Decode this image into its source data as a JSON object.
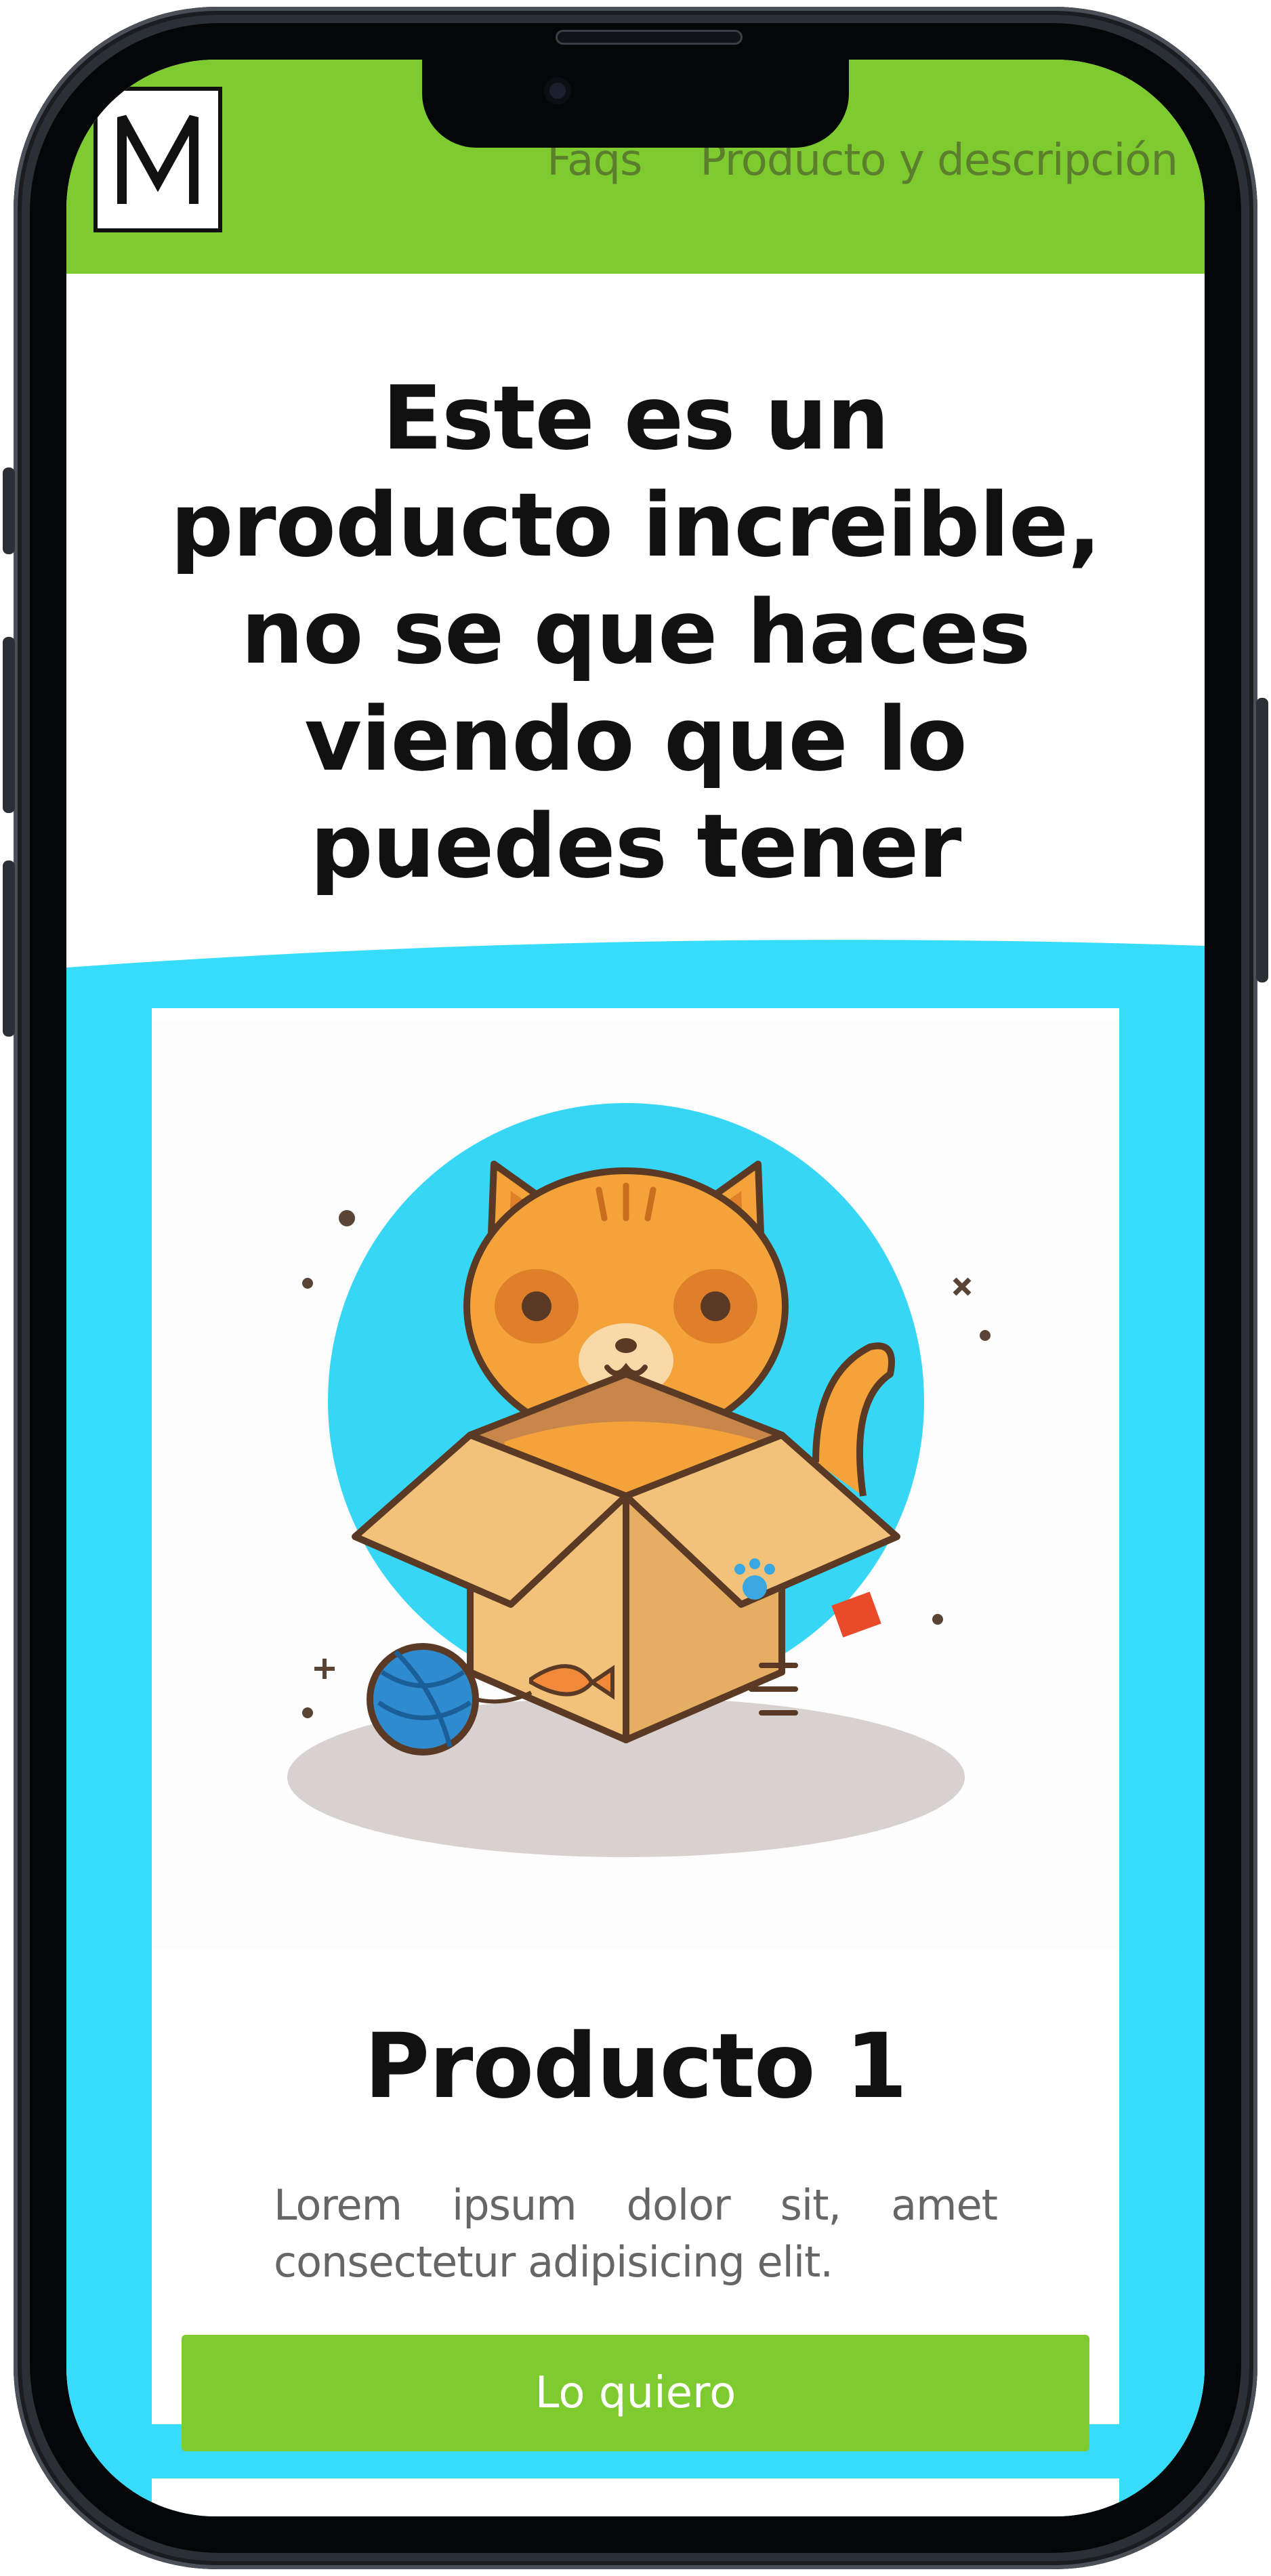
{
  "colors": {
    "header_bg": "#7ecb2f",
    "section_bg": "#38dcfb",
    "button_bg": "#7ecb2f",
    "button_text": "#ffffff",
    "nav_text": "#5c7f2e"
  },
  "header": {
    "logo_icon": "m-monogram-logo",
    "nav": [
      {
        "label": "Faqs"
      },
      {
        "label": "Producto y descripción"
      }
    ]
  },
  "hero": {
    "headline": "Este es un producto increible, no se que haces viendo que lo puedes tener"
  },
  "products": [
    {
      "image_icon": "cat-in-box-illustration",
      "title": "Producto 1",
      "description": "Lorem ipsum dolor sit, amet consectetur adipisicing elit.",
      "button_label": "Lo quiero"
    }
  ]
}
